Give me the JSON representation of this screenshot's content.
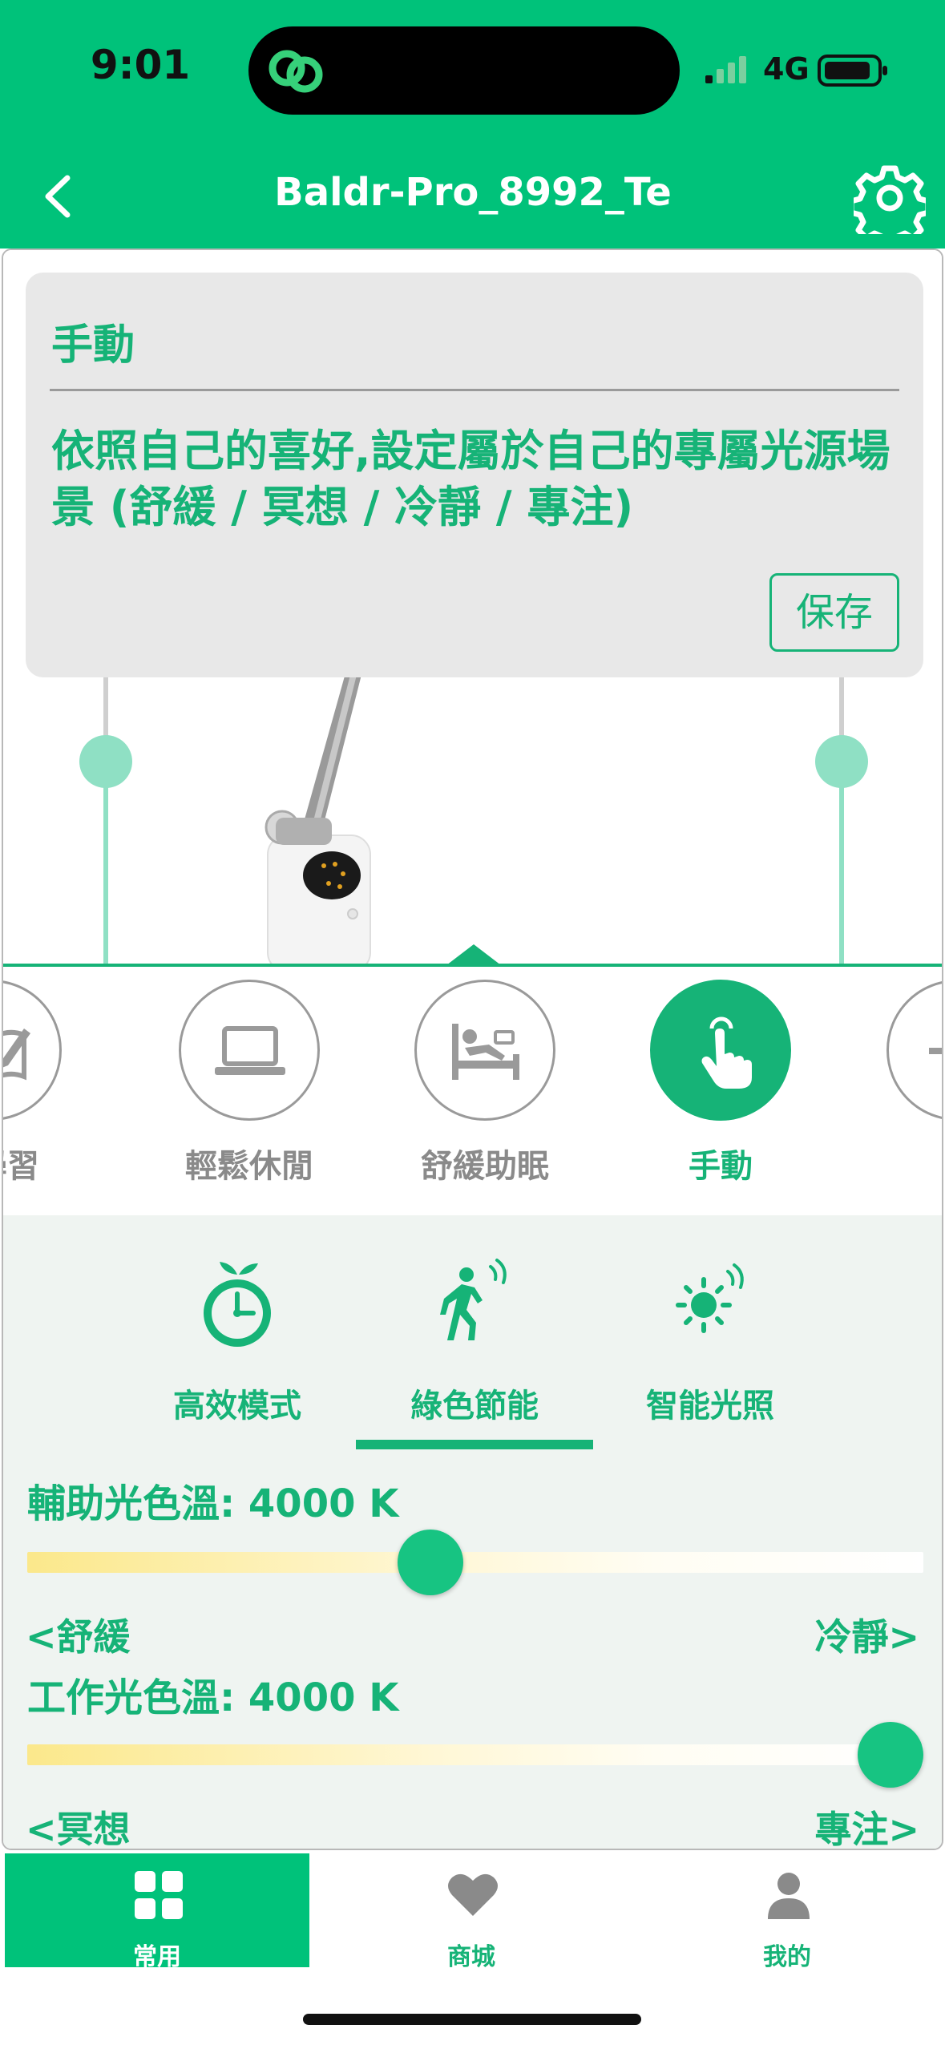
{
  "status_bar": {
    "time": "9:01",
    "network": "4G"
  },
  "header": {
    "title": "Baldr-Pro_8992_Te",
    "back_icon": "chevron-left-icon",
    "settings_icon": "gear-icon"
  },
  "info_card": {
    "title": "手動",
    "description": "依照自己的喜好,設定屬於自己的專屬光源場景 (舒緩 / 冥想 / 冷靜 / 專注)",
    "save_label": "保存"
  },
  "scenes": [
    {
      "label": "讀學習",
      "icon": "book-pen-icon",
      "active": false
    },
    {
      "label": "輕鬆休閒",
      "icon": "laptop-icon",
      "active": false
    },
    {
      "label": "舒緩助眠",
      "icon": "bed-icon",
      "active": false
    },
    {
      "label": "手動",
      "icon": "hand-pointer-icon",
      "active": true
    },
    {
      "label": "",
      "icon": "add-icon",
      "active": false
    }
  ],
  "modes": [
    {
      "label": "高效模式",
      "icon": "timer-icon",
      "selected": false
    },
    {
      "label": "綠色節能",
      "icon": "motion-sensor-icon",
      "selected": true
    },
    {
      "label": "智能光照",
      "icon": "light-sensor-icon",
      "selected": false
    }
  ],
  "sliders": {
    "aux": {
      "label": "輔助光色溫: 4000 K",
      "value_fraction": 0.45,
      "left_label": "<舒緩",
      "right_label": "冷靜>"
    },
    "work": {
      "label": "工作光色溫: 4000 K",
      "value_fraction": 1.0,
      "left_label": "<冥想",
      "right_label": "專注>"
    }
  },
  "tabs": [
    {
      "label": "常用",
      "icon": "grid-icon",
      "active": true
    },
    {
      "label": "商城",
      "icon": "heart-icon",
      "active": false
    },
    {
      "label": "我的",
      "icon": "user-icon",
      "active": false
    }
  ],
  "colors": {
    "brand_green": "#00c27a",
    "accent_green": "#16b377",
    "track_mint": "#8fe0c4"
  }
}
